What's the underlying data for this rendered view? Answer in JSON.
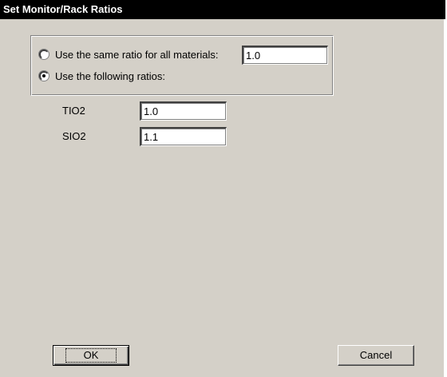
{
  "window": {
    "title": "Set Monitor/Rack Ratios"
  },
  "ratio_mode": {
    "same_ratio_label": "Use the same ratio for all materials:",
    "same_ratio_value": "1.0",
    "following_ratios_label": "Use the following ratios:",
    "selected": "following"
  },
  "materials": [
    {
      "name": "TIO2",
      "ratio": "1.0"
    },
    {
      "name": "SIO2",
      "ratio": "1.1"
    }
  ],
  "buttons": {
    "ok_label": "OK",
    "cancel_label": "Cancel"
  }
}
